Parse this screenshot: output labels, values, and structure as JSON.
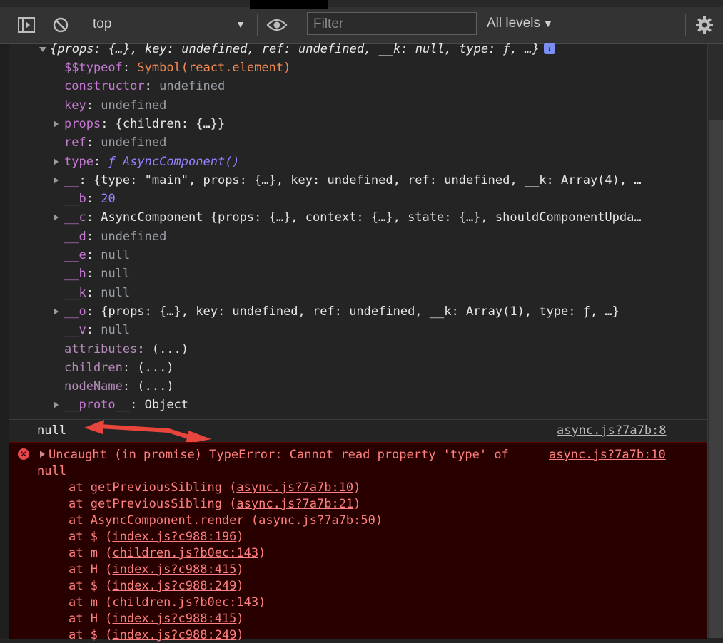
{
  "toolbar": {
    "context": "top",
    "filter_placeholder": "Filter",
    "levels": "All levels"
  },
  "object": {
    "summary": "{props: {…}, key: undefined, ref: undefined, __k: null, type: ƒ, …}",
    "info_badge": "i",
    "props": [
      {
        "key": "$$typeof",
        "sep": ": ",
        "value": "Symbol(react.element)",
        "vclass": "str",
        "expandable": false
      },
      {
        "key": "constructor",
        "sep": ": ",
        "value": "undefined",
        "vclass": "gray",
        "expandable": false
      },
      {
        "key": "key",
        "sep": ": ",
        "value": "undefined",
        "vclass": "gray",
        "expandable": false
      },
      {
        "key": "props",
        "sep": ": ",
        "value": "{children: {…}}",
        "vclass": "white",
        "expandable": true
      },
      {
        "key": "ref",
        "sep": ": ",
        "value": "undefined",
        "vclass": "gray",
        "expandable": false
      },
      {
        "key": "type",
        "sep": ": ",
        "value": "ƒ AsyncComponent()",
        "vclass": "fn",
        "expandable": true
      },
      {
        "key": "__",
        "sep": ": ",
        "value": "{type: \"main\", props: {…}, key: undefined, ref: undefined, __k: Array(4), …",
        "vclass": "white",
        "expandable": true
      },
      {
        "key": "__b",
        "sep": ": ",
        "value": "20",
        "vclass": "num",
        "expandable": false
      },
      {
        "key": "__c",
        "sep": ": ",
        "value": "AsyncComponent {props: {…}, context: {…}, state: {…}, shouldComponentUpda…",
        "vclass": "white",
        "expandable": true
      },
      {
        "key": "__d",
        "sep": ": ",
        "value": "undefined",
        "vclass": "gray",
        "expandable": false
      },
      {
        "key": "__e",
        "sep": ": ",
        "value": "null",
        "vclass": "gray",
        "expandable": false
      },
      {
        "key": "__h",
        "sep": ": ",
        "value": "null",
        "vclass": "gray",
        "expandable": false
      },
      {
        "key": "__k",
        "sep": ": ",
        "value": "null",
        "vclass": "gray",
        "expandable": false
      },
      {
        "key": "__o",
        "sep": ": ",
        "value": "{props: {…}, key: undefined, ref: undefined, __k: Array(1), type: ƒ, …}",
        "vclass": "white",
        "expandable": true
      },
      {
        "key": "__v",
        "sep": ": ",
        "value": "null",
        "vclass": "gray",
        "expandable": false
      },
      {
        "key": "attributes",
        "sep": ": ",
        "value": "(...)",
        "vclass": "white",
        "expandable": false
      },
      {
        "key": "children",
        "sep": ": ",
        "value": "(...)",
        "vclass": "white",
        "expandable": false
      },
      {
        "key": "nodeName",
        "sep": ": ",
        "value": "(...)",
        "vclass": "white",
        "expandable": false
      },
      {
        "key": "__proto__",
        "sep": ": ",
        "value": "Object",
        "vclass": "white",
        "expandable": true
      }
    ]
  },
  "null_message": {
    "text": "null",
    "source": "async.js?7a7b:8"
  },
  "error": {
    "message": "Uncaught (in promise) TypeError: Cannot read property 'type' of",
    "message_cont": "null",
    "source": "async.js?7a7b:10",
    "stack": [
      {
        "prefix": "at getPreviousSibling (",
        "link": "async.js?7a7b:10",
        "suffix": ")"
      },
      {
        "prefix": "at getPreviousSibling (",
        "link": "async.js?7a7b:21",
        "suffix": ")"
      },
      {
        "prefix": "at AsyncComponent.render (",
        "link": "async.js?7a7b:50",
        "suffix": ")"
      },
      {
        "prefix": "at $ (",
        "link": "index.js?c988:196",
        "suffix": ")"
      },
      {
        "prefix": "at m (",
        "link": "children.js?b0ec:143",
        "suffix": ")"
      },
      {
        "prefix": "at H (",
        "link": "index.js?c988:415",
        "suffix": ")"
      },
      {
        "prefix": "at $ (",
        "link": "index.js?c988:249",
        "suffix": ")"
      },
      {
        "prefix": "at m (",
        "link": "children.js?b0ec:143",
        "suffix": ")"
      },
      {
        "prefix": "at H (",
        "link": "index.js?c988:415",
        "suffix": ")"
      },
      {
        "prefix": "at $ (",
        "link": "index.js?c988:249",
        "suffix": ")"
      }
    ]
  },
  "colors": {
    "accent_error": "#ff8080",
    "error_bg": "#290000",
    "annotation_arrow": "#e8453c"
  },
  "icons": [
    "sidebar-toggle-icon",
    "clear-console-icon",
    "eye-icon",
    "gear-icon",
    "error-icon",
    "double-arrow-annotation"
  ]
}
